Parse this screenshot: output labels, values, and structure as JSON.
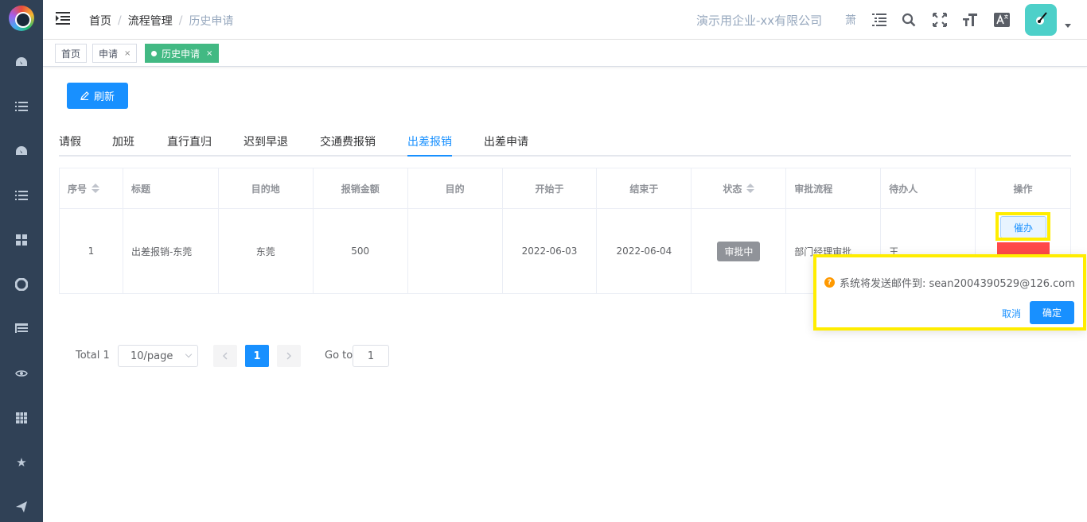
{
  "breadcrumb": [
    "首页",
    "流程管理",
    "历史申请"
  ],
  "company": "演示用企业-xx有限公司",
  "header_icon_char": "萧",
  "tags": [
    {
      "label": "首页",
      "closable": false
    },
    {
      "label": "申请",
      "closable": true
    },
    {
      "label": "历史申请",
      "closable": true,
      "active": true
    }
  ],
  "tag_close": "×",
  "refresh_label": "刷新",
  "tabs": [
    "请假",
    "加班",
    "直行直归",
    "迟到早退",
    "交通费报销",
    "出差报销",
    "出差申请"
  ],
  "active_tab_index": 5,
  "table": {
    "headers": [
      "序号",
      "标题",
      "目的地",
      "报销金额",
      "目的",
      "开始于",
      "结束于",
      "状态",
      "审批流程",
      "待办人",
      "操作"
    ],
    "rows": [
      {
        "index": "1",
        "title": "出差报销-东莞",
        "destination": "东莞",
        "amount": "500",
        "purpose": "",
        "start": "2022-06-03",
        "end": "2022-06-04",
        "status": "审批中",
        "flow": "部门经理审批",
        "assignee": "王"
      }
    ]
  },
  "actions": {
    "urge": "催办"
  },
  "popconfirm": {
    "message": "系统将发送邮件到: sean2004390529@126.com",
    "cancel": "取消",
    "confirm": "确定"
  },
  "pagination": {
    "total": "Total 1",
    "page_size": "10/page",
    "current": "1",
    "goto_label": "Go to",
    "goto_value": "1"
  },
  "colors": {
    "sidebar": "#304156",
    "primary": "#1890ff",
    "active_tag": "#42b983",
    "highlight": "#ffed00",
    "danger": "#ff4949"
  }
}
